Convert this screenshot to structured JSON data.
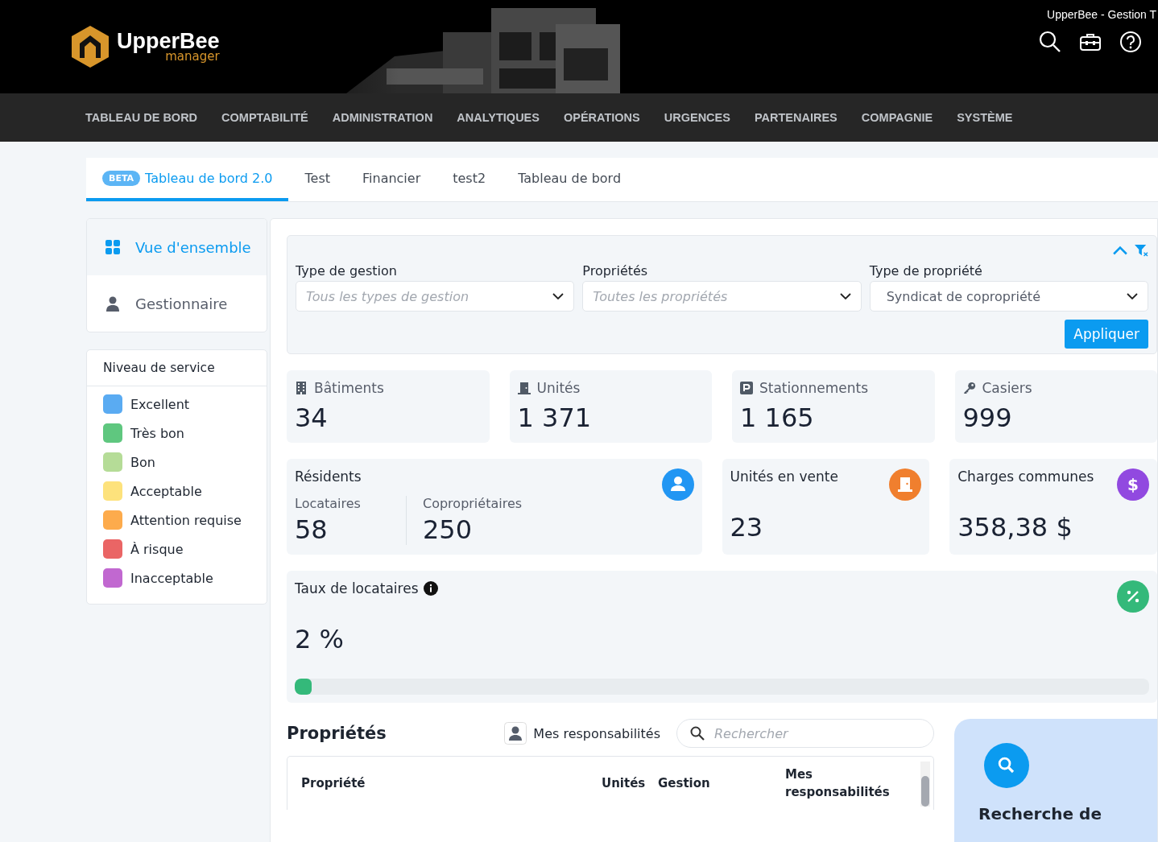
{
  "header": {
    "window_title": "UpperBee - Gestion T",
    "logo": {
      "name": "UpperBee",
      "tagline": "manager"
    }
  },
  "nav": [
    {
      "label": "TABLEAU DE BORD"
    },
    {
      "label": "COMPTABILITÉ"
    },
    {
      "label": "ADMINISTRATION"
    },
    {
      "label": "ANALYTIQUES"
    },
    {
      "label": "OPÉRATIONS"
    },
    {
      "label": "URGENCES"
    },
    {
      "label": "PARTENAIRES"
    },
    {
      "label": "COMPAGNIE"
    },
    {
      "label": "SYSTÈME"
    }
  ],
  "tabs": [
    {
      "label": "Tableau de bord 2.0",
      "badge": "BETA",
      "selected": true
    },
    {
      "label": "Test",
      "selected": false
    },
    {
      "label": "Financier",
      "selected": false
    },
    {
      "label": "test2",
      "selected": false
    },
    {
      "label": "Tableau de bord",
      "selected": false
    }
  ],
  "sidebar": {
    "items": [
      {
        "label": "Vue d'ensemble",
        "kind": "grid",
        "selected": true
      },
      {
        "label": "Gestionnaire",
        "kind": "person",
        "selected": false
      }
    ],
    "service_levels": {
      "title": "Niveau de service",
      "items": [
        {
          "label": "Excellent",
          "color": "#5aabf2"
        },
        {
          "label": "Très bon",
          "color": "#5fc77f"
        },
        {
          "label": "Bon",
          "color": "#b5dc97"
        },
        {
          "label": "Acceptable",
          "color": "#fde27c"
        },
        {
          "label": "Attention requise",
          "color": "#fdab4c"
        },
        {
          "label": "À risque",
          "color": "#ea6565"
        },
        {
          "label": "Inacceptable",
          "color": "#c168d0"
        }
      ]
    }
  },
  "filters": {
    "fields": [
      {
        "label": "Type de gestion",
        "placeholder": "Tous les types de gestion"
      },
      {
        "label": "Propriétés",
        "placeholder": "Toutes les propriétés"
      },
      {
        "label": "Type de propriété",
        "value": "Syndicat de copropriété"
      }
    ],
    "apply": "Appliquer"
  },
  "stats": [
    {
      "label": "Bâtiments",
      "value": "34",
      "kind": "building"
    },
    {
      "label": "Unités",
      "value": "1 371",
      "kind": "door"
    },
    {
      "label": "Stationnements",
      "value": "1 165",
      "kind": "parking"
    },
    {
      "label": "Casiers",
      "value": "999",
      "kind": "key"
    }
  ],
  "residents": {
    "title": "Résidents",
    "groups": [
      {
        "label": "Locataires",
        "value": "58"
      },
      {
        "label": "Copropriétaires",
        "value": "250"
      }
    ]
  },
  "cards": [
    {
      "title": "Unités en vente",
      "value": "23",
      "kind": "door"
    },
    {
      "title": "Charges communes",
      "value": "358,38 $",
      "kind": "dollar",
      "symbol": "$"
    }
  ],
  "tenant_rate": {
    "title": "Taux de locataires",
    "value": "2 %",
    "level": 0.02
  },
  "properties": {
    "title": "Propriétés",
    "toggle": "Mes responsabilités",
    "search_placeholder": "Rechercher",
    "columns": [
      "Propriété",
      "Unités",
      "Gestion",
      "Mes responsabilités"
    ]
  },
  "search_card": {
    "title": "Recherche de"
  }
}
